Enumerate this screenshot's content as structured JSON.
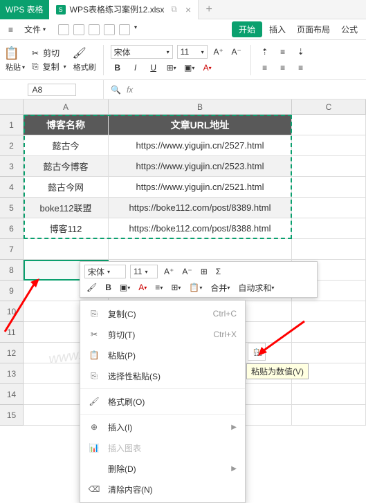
{
  "app": {
    "name": "WPS 表格"
  },
  "tab": {
    "filename": "WPS表格练习案例12.xlsx"
  },
  "menu": {
    "file": "文件",
    "start": "开始",
    "insert": "插入",
    "layout": "页面布局",
    "formula": "公式"
  },
  "ribbon": {
    "paste": "粘贴",
    "cut": "剪切",
    "copy": "复制",
    "format_painter": "格式刷",
    "font": "宋体",
    "size": "11",
    "merge": "合并",
    "autosum": "自动求和"
  },
  "namebox": "A8",
  "fx": "fx",
  "cols": {
    "a": "A",
    "b": "B",
    "c": "C"
  },
  "rows": [
    "1",
    "2",
    "3",
    "4",
    "5",
    "6",
    "7",
    "8",
    "9",
    "10",
    "11",
    "12",
    "13",
    "14",
    "15"
  ],
  "table": {
    "header": {
      "name": "博客名称",
      "url": "文章URL地址"
    },
    "data": [
      {
        "name": "懿古今",
        "url": "https://www.yigujin.cn/2527.html"
      },
      {
        "name": "懿古今博客",
        "url": "https://www.yigujin.cn/2523.html"
      },
      {
        "name": "懿古今网",
        "url": "https://www.yigujin.cn/2521.html"
      },
      {
        "name": "boke112联盟",
        "url": "https://boke112.com/post/8389.html"
      },
      {
        "name": "博客112",
        "url": "https://boke112.com/post/8388.html"
      }
    ]
  },
  "mini": {
    "font": "宋体",
    "size": "11",
    "merge": "合并",
    "autosum": "自动求和"
  },
  "ctx": {
    "copy": "复制(C)",
    "copy_sc": "Ctrl+C",
    "cut": "剪切(T)",
    "cut_sc": "Ctrl+X",
    "paste": "粘贴(P)",
    "paste_special": "选择性粘贴(S)",
    "format_painter": "格式刷(O)",
    "insert": "插入(I)",
    "insert_chart": "插入图表",
    "delete": "删除(D)",
    "clear": "清除内容(N)"
  },
  "tooltip": "粘贴为数值(V)",
  "watermark": "www.yigujin.cn",
  "chart_data": {
    "type": "table",
    "title": "",
    "columns": [
      "博客名称",
      "文章URL地址"
    ],
    "rows": [
      [
        "懿古今",
        "https://www.yigujin.cn/2527.html"
      ],
      [
        "懿古今博客",
        "https://www.yigujin.cn/2523.html"
      ],
      [
        "懿古今网",
        "https://www.yigujin.cn/2521.html"
      ],
      [
        "boke112联盟",
        "https://boke112.com/post/8389.html"
      ],
      [
        "博客112",
        "https://boke112.com/post/8388.html"
      ]
    ]
  }
}
